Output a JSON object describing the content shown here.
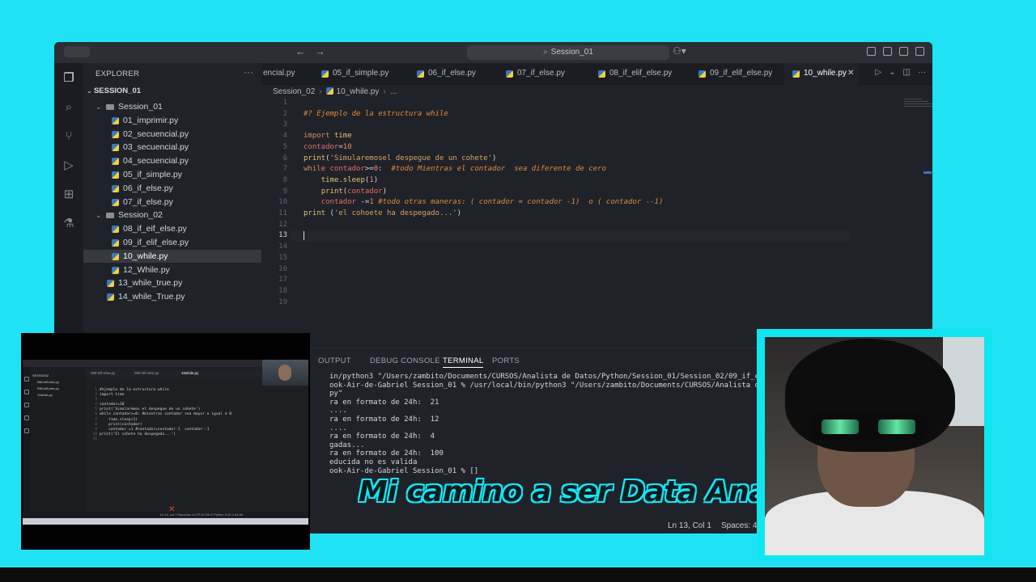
{
  "titlebar": {
    "search_text": "Session_01"
  },
  "explorer": {
    "title": "EXPLORER",
    "more": "···",
    "root": "SESSION_01",
    "tree": [
      {
        "label": "Session_01",
        "kind": "folder",
        "indent": 1
      },
      {
        "label": "01_imprimir.py",
        "kind": "py",
        "indent": 2
      },
      {
        "label": "02_secuencial.py",
        "kind": "py",
        "indent": 2
      },
      {
        "label": "03_secuencial.py",
        "kind": "py",
        "indent": 2
      },
      {
        "label": "04_secuencial.py",
        "kind": "py",
        "indent": 2
      },
      {
        "label": "05_if_simple.py",
        "kind": "py",
        "indent": 2
      },
      {
        "label": "06_if_else.py",
        "kind": "py",
        "indent": 2
      },
      {
        "label": "07_if_else.py",
        "kind": "py",
        "indent": 2
      },
      {
        "label": "Session_02",
        "kind": "folder",
        "indent": 1
      },
      {
        "label": "08_if_eif_else.py",
        "kind": "py",
        "indent": 2
      },
      {
        "label": "09_if_elif_else.py",
        "kind": "py",
        "indent": 2
      },
      {
        "label": "10_while.py",
        "kind": "py",
        "indent": 2,
        "selected": true
      },
      {
        "label": "12_While.py",
        "kind": "py",
        "indent": 2
      },
      {
        "label": "13_while_true.py",
        "kind": "py",
        "indent": 1
      },
      {
        "label": "14_while_True.py",
        "kind": "py",
        "indent": 1
      }
    ]
  },
  "tabs": [
    {
      "label": "encial.py",
      "icon": false
    },
    {
      "label": "05_if_simple.py",
      "icon": true
    },
    {
      "label": "06_if_else.py",
      "icon": true
    },
    {
      "label": "07_if_else.py",
      "icon": true
    },
    {
      "label": "08_if_elif_else.py",
      "icon": true
    },
    {
      "label": "09_if_elif_else.py",
      "icon": true
    },
    {
      "label": "10_while.py",
      "icon": true,
      "active": true
    }
  ],
  "breadcrumb": {
    "folder": "Session_02",
    "file": "10_while.py",
    "more": "..."
  },
  "editor": {
    "line_numbers": [
      "1",
      "2",
      "3",
      "4",
      "5",
      "6",
      "7",
      "8",
      "9",
      "10",
      "11",
      "12",
      "13",
      "14",
      "15",
      "16",
      "17",
      "18",
      "19"
    ],
    "current_line": "13"
  },
  "panel": {
    "tabs": [
      "OUTPUT",
      "DEBUG CONSOLE",
      "TERMINAL",
      "PORTS"
    ],
    "active_tab": "TERMINAL",
    "terminal_lines": [
      "in/python3 \"/Users/zambito/Documents/CURSOS/Analista de Datos/Python/Session_01/Session_02/09_if_eli",
      "ook-Air-de-Gabriel Session_01 % /usr/local/bin/python3 \"/Users/zambito/Documents/CURSOS/Analista de",
      "py\"",
      "ra en formato de 24h:  21",
      "....",
      "ra en formato de 24h:  12",
      "....",
      "ra en formato de 24h:  4",
      "gadas...",
      "ra en formato de 24h:  100",
      "educida no es valida",
      "ook-Air-de-Gabriel Session_01 % []"
    ]
  },
  "statusbar": {
    "position": "Ln 13, Col 1",
    "spaces": "Spaces: 4"
  },
  "overlay": {
    "banner": "Mi camino a ser Data Analyst"
  },
  "mini_screen": {
    "tabs": [
      "08if-elif-else.py",
      "09if-elif-else.py",
      "10while.py"
    ],
    "folder": "SESSION2",
    "files": [
      "08if-elif-else.py",
      "09if-elif-else.py",
      "10while.py"
    ],
    "line_numbers": "1\n2\n3\n4\n5\n6\n7\n8\n9\n10\n11",
    "code_lines": "#ejemplo de la estructura while\nimport time\n\ncontador=10\nprint('Simularemos el despegue de un cohete')\nwhile contador>=0: #mientras contador sea mayor o igual a 0\n    time.sleep(1)\n    print(contador)\n    contador-=1 #contador=contador-1  contador--1\nprint('El cohete ha despegado...')\n",
    "status_text": "Ln 11, col 1   Espacios 4   UTF-8   CRLF   Python   3.10.2 64-bit"
  },
  "colors": {
    "background": "#1fe3f5",
    "editor_bg": "#1f2228",
    "accent": "#3e6fd0"
  }
}
